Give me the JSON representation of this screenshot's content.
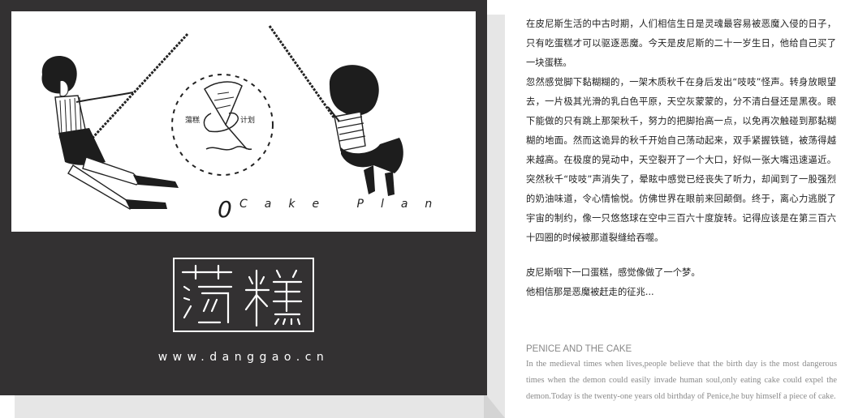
{
  "poster": {
    "badge_left": "蕩糕",
    "badge_right": "计划",
    "tagline_zero": "0",
    "tagline_text": "Cake Plan",
    "logo_text": "荡糕",
    "url": "www.danggao.cn"
  },
  "story": {
    "paragraphs": [
      "在皮尼斯生活的中古时期，人们相信生日是灵魂最容易被恶魔入侵的日子，只有吃蛋糕才可以驱逐恶魔。今天是皮尼斯的二十一岁生日，他给自己买了一块蛋糕。",
      "忽然感觉脚下黏糊糊的，一架木质秋千在身后发出“吱吱”怪声。转身放眼望去，一片极其光滑的乳白色平原，天空灰蒙蒙的，分不清白昼还是黑夜。眼下能做的只有跳上那架秋千，努力的把脚抬高一点，以免再次触碰到那黏糊糊的地面。然而这诡异的秋千开始自己荡动起来，双手紧握铁链，被荡得越来越高。在极度的晃动中，天空裂开了一个大口，好似一张大嘴迅速逼近。突然秋千“吱吱”声消失了，晕眩中感觉已经丧失了听力，却闻到了一股强烈的奶油味道，令心情愉悦。仿佛世界在眼前来回颠倒。终于，离心力逃脱了宇宙的制约，像一只悠悠球在空中三百六十度旋转。记得应该是在第三百六十四圈的时候被那道裂缝给吞噬。"
    ],
    "closing": [
      "皮尼斯咽下一口蛋糕，感觉像做了一个梦。",
      "他相信那是恶魔被赶走的征兆..."
    ],
    "en_title": "PENICE AND THE CAKE",
    "en_body": "In the medieval times when lives,people believe that the birth day is the most dangerous times when the demon could easily invade human soul,only eating cake could expel the demon.Today is the twenty-one years old birthday of Penice,he buy himself a piece of cake."
  }
}
